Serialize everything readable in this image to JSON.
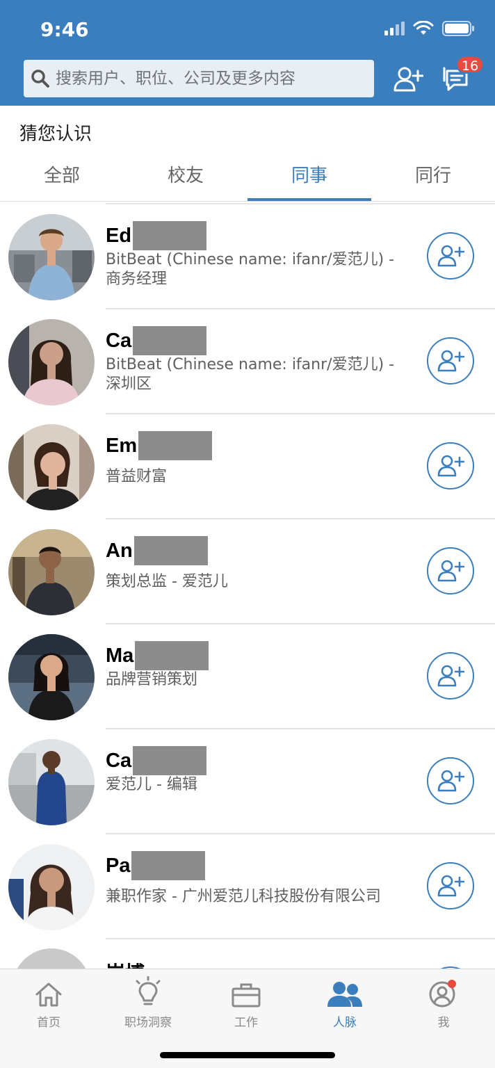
{
  "status_bar": {
    "time": "9:46"
  },
  "search": {
    "placeholder": "搜索用户、职位、公司及更多内容"
  },
  "header": {
    "message_badge": "16"
  },
  "section_title": "猜您认识",
  "tabs": [
    {
      "label": "全部",
      "active": false
    },
    {
      "label": "校友",
      "active": false
    },
    {
      "label": "同事",
      "active": true
    },
    {
      "label": "同行",
      "active": false
    }
  ],
  "people": [
    {
      "name": "Ed",
      "description": "BitBeat (Chinese name: ifanr/爱范儿) - 商务经理"
    },
    {
      "name": "Ca",
      "description": "BitBeat (Chinese name: ifanr/爱范儿) - 深圳区"
    },
    {
      "name": "Em",
      "description": "普益财富"
    },
    {
      "name": "An",
      "description": "策划总监 - 爱范儿"
    },
    {
      "name": "Ma",
      "description": "品牌营销策划"
    },
    {
      "name": "Ca",
      "description": "爱范儿 - 编辑"
    },
    {
      "name": "Pa",
      "description": "兼职作家 - 广州爱范儿科技股份有限公司"
    }
  ],
  "partial_person": {
    "name": "岸博"
  },
  "bottom_nav": [
    {
      "label": "首页",
      "icon": "home-icon"
    },
    {
      "label": "职场洞察",
      "icon": "lightbulb-icon"
    },
    {
      "label": "工作",
      "icon": "briefcase-icon"
    },
    {
      "label": "人脉",
      "icon": "people-icon",
      "active": true
    },
    {
      "label": "我",
      "icon": "profile-icon"
    }
  ],
  "colors": {
    "brand": "#3a7ebe",
    "badge": "#e84a3f"
  }
}
